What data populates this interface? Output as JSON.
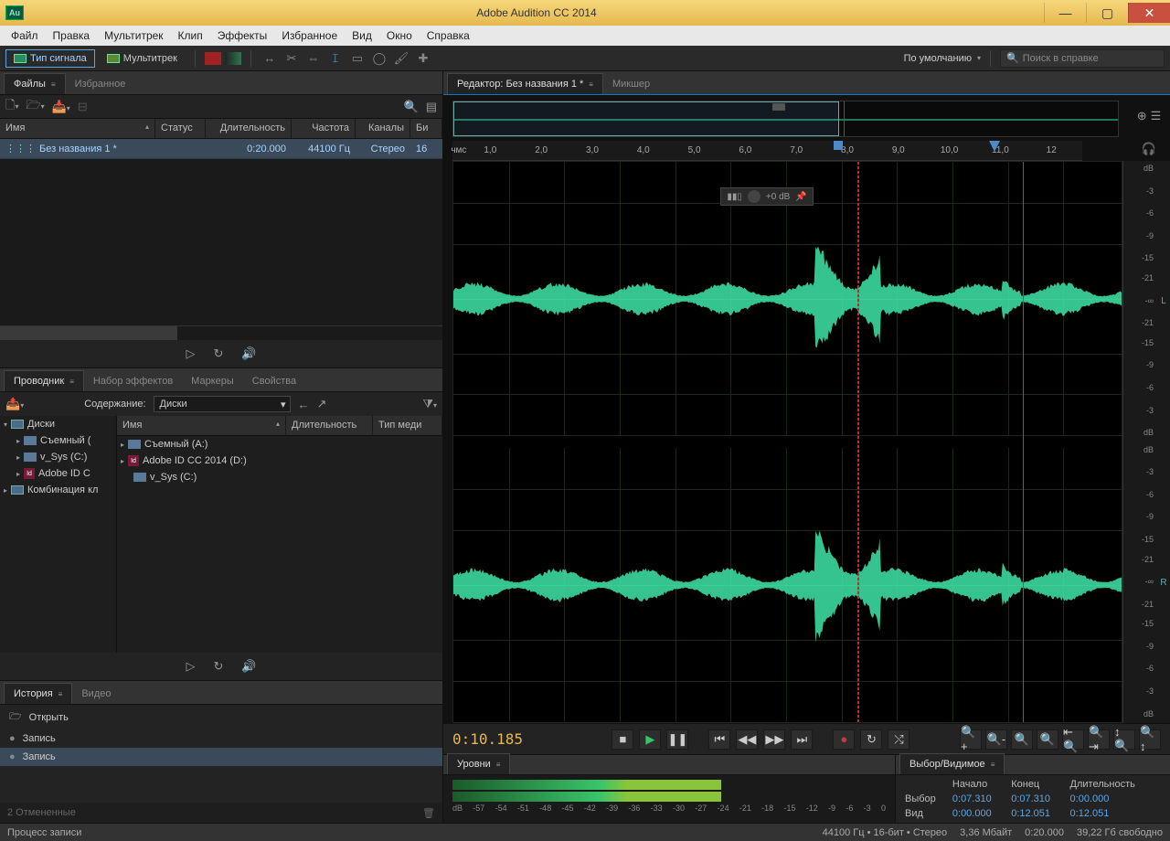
{
  "app": {
    "title": "Adobe Audition CC 2014",
    "icon": "Au"
  },
  "menu": [
    "Файл",
    "Правка",
    "Мультитрек",
    "Клип",
    "Эффекты",
    "Избранное",
    "Вид",
    "Окно",
    "Справка"
  ],
  "modes": {
    "waveform": "Тип сигнала",
    "multitrack": "Мультитрек"
  },
  "workspace": {
    "default": "По умолчанию",
    "search_placeholder": "Поиск в справке"
  },
  "files_panel": {
    "tabs": [
      "Файлы",
      "Избранное"
    ],
    "columns": {
      "name": "Имя",
      "status": "Статус",
      "duration": "Длительность",
      "freq": "Частота",
      "channels": "Каналы",
      "bits": "Би"
    },
    "rows": [
      {
        "name": "Без названия 1 *",
        "duration": "0:20.000",
        "freq": "44100 Гц",
        "channels": "Стерео",
        "bits": "16"
      }
    ]
  },
  "browser_panel": {
    "tabs": [
      "Проводник",
      "Набор эффектов",
      "Маркеры",
      "Свойства"
    ],
    "contents_label": "Содержание:",
    "contents_value": "Диски",
    "tree": [
      {
        "label": "Диски",
        "expanded": true,
        "children": [
          {
            "label": "Съемный ("
          },
          {
            "label": "v_Sys (C:)"
          },
          {
            "label": "Adobe ID C"
          }
        ]
      },
      {
        "label": "Комбинация кл"
      }
    ],
    "list_columns": {
      "name": "Имя",
      "duration": "Длительность",
      "media": "Тип меди"
    },
    "list": [
      {
        "label": "Съемный (A:)"
      },
      {
        "label": "Adobe ID CC 2014 (D:)"
      },
      {
        "label": "v_Sys (C:)"
      }
    ]
  },
  "history_panel": {
    "tabs": [
      "История",
      "Видео"
    ],
    "items": [
      {
        "label": "Открыть",
        "icon": "open"
      },
      {
        "label": "Запись",
        "icon": "rec"
      },
      {
        "label": "Запись",
        "icon": "rec",
        "selected": true
      }
    ],
    "undo_text": "2 Отмененные"
  },
  "editor": {
    "tabs": [
      "Редактор: Без названия 1 *",
      "Микшер"
    ],
    "ruler_label": "чмс",
    "ruler_ticks": [
      "1,0",
      "2,0",
      "3,0",
      "4,0",
      "5,0",
      "6,0",
      "7,0",
      "8,0",
      "9,0",
      "10,0",
      "11,0",
      "12"
    ],
    "db_label": "+0 dB",
    "db_scale": [
      "dB",
      "-3",
      "-6",
      "-9",
      "-15",
      "-21",
      "-∞",
      "-21",
      "-15",
      "-9",
      "-6",
      "-3",
      "dB"
    ],
    "channels": [
      "L",
      "R"
    ],
    "timecode": "0:10.185"
  },
  "levels_panel": {
    "title": "Уровни",
    "scale": [
      "dB",
      "-57",
      "-54",
      "-51",
      "-48",
      "-45",
      "-42",
      "-39",
      "-36",
      "-33",
      "-30",
      "-27",
      "-24",
      "-21",
      "-18",
      "-15",
      "-12",
      "-9",
      "-6",
      "-3",
      "0"
    ]
  },
  "selection_panel": {
    "title": "Выбор/Видимое",
    "headers": [
      "",
      "Начало",
      "Конец",
      "Длительность"
    ],
    "rows": [
      {
        "label": "Выбор",
        "start": "0:07.310",
        "end": "0:07.310",
        "dur": "0:00.000"
      },
      {
        "label": "Вид",
        "start": "0:00.000",
        "end": "0:12.051",
        "dur": "0:12.051"
      }
    ]
  },
  "status": {
    "process": "Процесс записи",
    "sample": "44100 Гц • 16-бит • Стерео",
    "size": "3,36 Мбайт",
    "duration": "0:20.000",
    "free": "39,22 Гб свободно"
  }
}
